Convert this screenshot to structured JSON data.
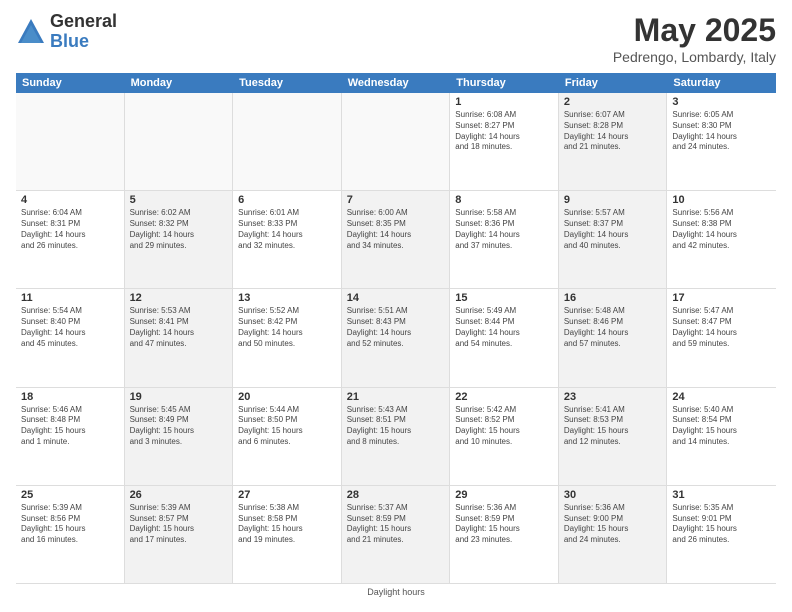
{
  "header": {
    "logo_general": "General",
    "logo_blue": "Blue",
    "main_title": "May 2025",
    "subtitle": "Pedrengo, Lombardy, Italy"
  },
  "calendar": {
    "days_of_week": [
      "Sunday",
      "Monday",
      "Tuesday",
      "Wednesday",
      "Thursday",
      "Friday",
      "Saturday"
    ],
    "weeks": [
      [
        {
          "day": "",
          "info": "",
          "shaded": false,
          "empty": true
        },
        {
          "day": "",
          "info": "",
          "shaded": false,
          "empty": true
        },
        {
          "day": "",
          "info": "",
          "shaded": false,
          "empty": true
        },
        {
          "day": "",
          "info": "",
          "shaded": false,
          "empty": true
        },
        {
          "day": "1",
          "info": "Sunrise: 6:08 AM\nSunset: 8:27 PM\nDaylight: 14 hours\nand 18 minutes.",
          "shaded": false,
          "empty": false
        },
        {
          "day": "2",
          "info": "Sunrise: 6:07 AM\nSunset: 8:28 PM\nDaylight: 14 hours\nand 21 minutes.",
          "shaded": true,
          "empty": false
        },
        {
          "day": "3",
          "info": "Sunrise: 6:05 AM\nSunset: 8:30 PM\nDaylight: 14 hours\nand 24 minutes.",
          "shaded": false,
          "empty": false
        }
      ],
      [
        {
          "day": "4",
          "info": "Sunrise: 6:04 AM\nSunset: 8:31 PM\nDaylight: 14 hours\nand 26 minutes.",
          "shaded": false,
          "empty": false
        },
        {
          "day": "5",
          "info": "Sunrise: 6:02 AM\nSunset: 8:32 PM\nDaylight: 14 hours\nand 29 minutes.",
          "shaded": true,
          "empty": false
        },
        {
          "day": "6",
          "info": "Sunrise: 6:01 AM\nSunset: 8:33 PM\nDaylight: 14 hours\nand 32 minutes.",
          "shaded": false,
          "empty": false
        },
        {
          "day": "7",
          "info": "Sunrise: 6:00 AM\nSunset: 8:35 PM\nDaylight: 14 hours\nand 34 minutes.",
          "shaded": true,
          "empty": false
        },
        {
          "day": "8",
          "info": "Sunrise: 5:58 AM\nSunset: 8:36 PM\nDaylight: 14 hours\nand 37 minutes.",
          "shaded": false,
          "empty": false
        },
        {
          "day": "9",
          "info": "Sunrise: 5:57 AM\nSunset: 8:37 PM\nDaylight: 14 hours\nand 40 minutes.",
          "shaded": true,
          "empty": false
        },
        {
          "day": "10",
          "info": "Sunrise: 5:56 AM\nSunset: 8:38 PM\nDaylight: 14 hours\nand 42 minutes.",
          "shaded": false,
          "empty": false
        }
      ],
      [
        {
          "day": "11",
          "info": "Sunrise: 5:54 AM\nSunset: 8:40 PM\nDaylight: 14 hours\nand 45 minutes.",
          "shaded": false,
          "empty": false
        },
        {
          "day": "12",
          "info": "Sunrise: 5:53 AM\nSunset: 8:41 PM\nDaylight: 14 hours\nand 47 minutes.",
          "shaded": true,
          "empty": false
        },
        {
          "day": "13",
          "info": "Sunrise: 5:52 AM\nSunset: 8:42 PM\nDaylight: 14 hours\nand 50 minutes.",
          "shaded": false,
          "empty": false
        },
        {
          "day": "14",
          "info": "Sunrise: 5:51 AM\nSunset: 8:43 PM\nDaylight: 14 hours\nand 52 minutes.",
          "shaded": true,
          "empty": false
        },
        {
          "day": "15",
          "info": "Sunrise: 5:49 AM\nSunset: 8:44 PM\nDaylight: 14 hours\nand 54 minutes.",
          "shaded": false,
          "empty": false
        },
        {
          "day": "16",
          "info": "Sunrise: 5:48 AM\nSunset: 8:46 PM\nDaylight: 14 hours\nand 57 minutes.",
          "shaded": true,
          "empty": false
        },
        {
          "day": "17",
          "info": "Sunrise: 5:47 AM\nSunset: 8:47 PM\nDaylight: 14 hours\nand 59 minutes.",
          "shaded": false,
          "empty": false
        }
      ],
      [
        {
          "day": "18",
          "info": "Sunrise: 5:46 AM\nSunset: 8:48 PM\nDaylight: 15 hours\nand 1 minute.",
          "shaded": false,
          "empty": false
        },
        {
          "day": "19",
          "info": "Sunrise: 5:45 AM\nSunset: 8:49 PM\nDaylight: 15 hours\nand 3 minutes.",
          "shaded": true,
          "empty": false
        },
        {
          "day": "20",
          "info": "Sunrise: 5:44 AM\nSunset: 8:50 PM\nDaylight: 15 hours\nand 6 minutes.",
          "shaded": false,
          "empty": false
        },
        {
          "day": "21",
          "info": "Sunrise: 5:43 AM\nSunset: 8:51 PM\nDaylight: 15 hours\nand 8 minutes.",
          "shaded": true,
          "empty": false
        },
        {
          "day": "22",
          "info": "Sunrise: 5:42 AM\nSunset: 8:52 PM\nDaylight: 15 hours\nand 10 minutes.",
          "shaded": false,
          "empty": false
        },
        {
          "day": "23",
          "info": "Sunrise: 5:41 AM\nSunset: 8:53 PM\nDaylight: 15 hours\nand 12 minutes.",
          "shaded": true,
          "empty": false
        },
        {
          "day": "24",
          "info": "Sunrise: 5:40 AM\nSunset: 8:54 PM\nDaylight: 15 hours\nand 14 minutes.",
          "shaded": false,
          "empty": false
        }
      ],
      [
        {
          "day": "25",
          "info": "Sunrise: 5:39 AM\nSunset: 8:56 PM\nDaylight: 15 hours\nand 16 minutes.",
          "shaded": false,
          "empty": false
        },
        {
          "day": "26",
          "info": "Sunrise: 5:39 AM\nSunset: 8:57 PM\nDaylight: 15 hours\nand 17 minutes.",
          "shaded": true,
          "empty": false
        },
        {
          "day": "27",
          "info": "Sunrise: 5:38 AM\nSunset: 8:58 PM\nDaylight: 15 hours\nand 19 minutes.",
          "shaded": false,
          "empty": false
        },
        {
          "day": "28",
          "info": "Sunrise: 5:37 AM\nSunset: 8:59 PM\nDaylight: 15 hours\nand 21 minutes.",
          "shaded": true,
          "empty": false
        },
        {
          "day": "29",
          "info": "Sunrise: 5:36 AM\nSunset: 8:59 PM\nDaylight: 15 hours\nand 23 minutes.",
          "shaded": false,
          "empty": false
        },
        {
          "day": "30",
          "info": "Sunrise: 5:36 AM\nSunset: 9:00 PM\nDaylight: 15 hours\nand 24 minutes.",
          "shaded": true,
          "empty": false
        },
        {
          "day": "31",
          "info": "Sunrise: 5:35 AM\nSunset: 9:01 PM\nDaylight: 15 hours\nand 26 minutes.",
          "shaded": false,
          "empty": false
        }
      ]
    ]
  },
  "footer": {
    "note": "Daylight hours"
  }
}
